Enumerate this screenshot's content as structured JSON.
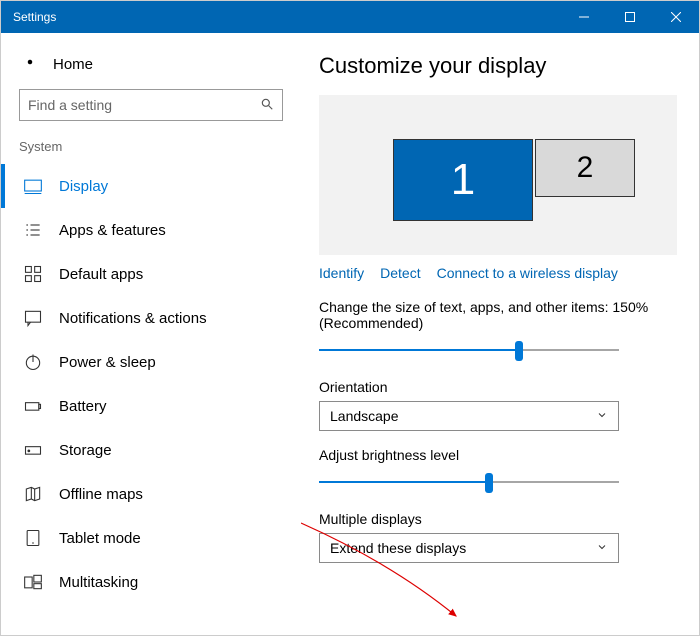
{
  "window": {
    "title": "Settings"
  },
  "sidebar": {
    "home": "Home",
    "search_placeholder": "Find a setting",
    "section": "System",
    "items": [
      {
        "label": "Display"
      },
      {
        "label": "Apps & features"
      },
      {
        "label": "Default apps"
      },
      {
        "label": "Notifications & actions"
      },
      {
        "label": "Power & sleep"
      },
      {
        "label": "Battery"
      },
      {
        "label": "Storage"
      },
      {
        "label": "Offline maps"
      },
      {
        "label": "Tablet mode"
      },
      {
        "label": "Multitasking"
      }
    ]
  },
  "main": {
    "heading": "Customize your display",
    "monitor1": "1",
    "monitor2": "2",
    "link_identify": "Identify",
    "link_detect": "Detect",
    "link_wireless": "Connect to a wireless display",
    "scale_text": "Change the size of text, apps, and other items: 150% (Recommended)",
    "orientation_label": "Orientation",
    "orientation_value": "Landscape",
    "brightness_label": "Adjust brightness level",
    "multiple_label": "Multiple displays",
    "multiple_value": "Extend these displays"
  }
}
